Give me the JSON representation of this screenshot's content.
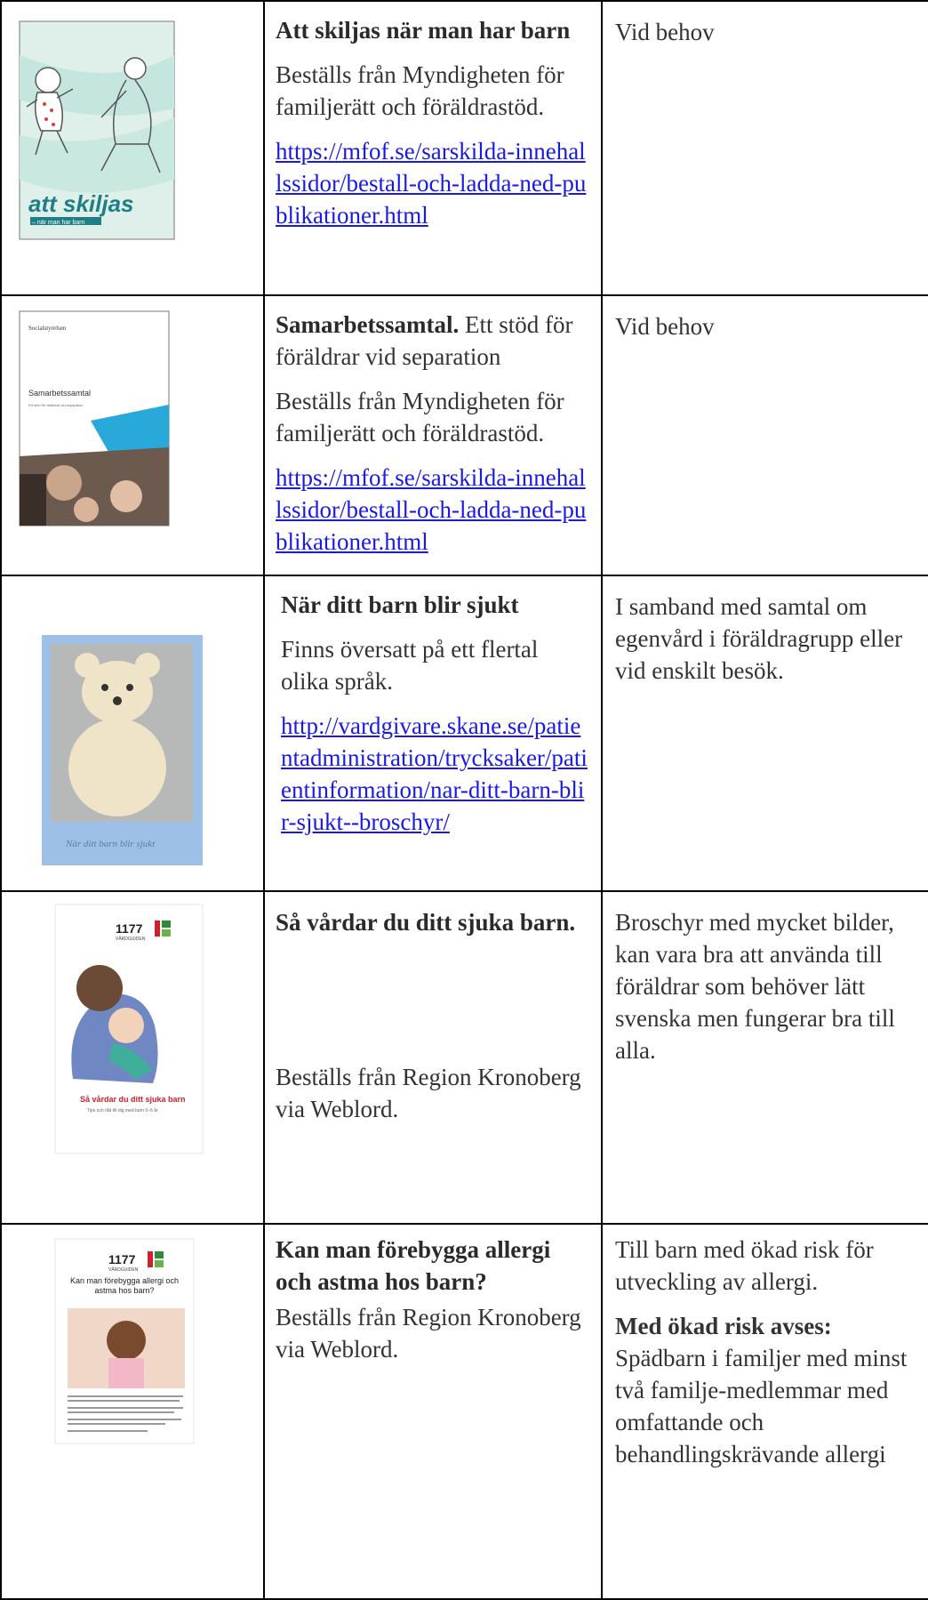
{
  "rows": [
    {
      "title": "Att skiljas när man har barn",
      "subtitle": "",
      "order": "Beställs från Myndigheten för familjerätt och föräldrastöd.",
      "link": "https://mfof.se/sarskilda-innehallssidor/bestall-och-ladda-ned-publikationer.html",
      "when": "Vid behov",
      "cover": {
        "title": "att skiljas",
        "subtitle": "– när man har barn"
      }
    },
    {
      "title": "Samarbetssamtal.",
      "subtitle": " Ett stöd för föräldrar vid separation",
      "order": "Beställs från Myndigheten för familjerätt och föräldrastöd.",
      "link": "https://mfof.se/sarskilda-innehallssidor/bestall-och-ladda-ned-publikationer.html",
      "when": "Vid behov",
      "cover": {
        "publisher": "Socialstyrelsen",
        "title": "Samarbetssamtal",
        "subtitle": "Ett stöd för föräldrar vid separation"
      }
    },
    {
      "title": "När ditt barn blir sjukt",
      "order": "Finns översatt på ett flertal olika språk.",
      "link": "http://vardgivare.skane.se/patientadministration/trycksaker/patientinformation/nar-ditt-barn-blir-sjukt--broschyr/",
      "when": "I samband med samtal om egenvård i föräldragrupp eller vid enskilt besök.",
      "cover": {
        "title": "När ditt barn blir sjukt"
      }
    },
    {
      "title": "Så vårdar du ditt sjuka barn.",
      "order": "Beställs från Region Kronoberg via Weblord.",
      "when": "Broschyr med mycket bilder, kan vara bra att använda till föräldrar som behöver lätt svenska men fungerar bra till alla.",
      "cover": {
        "brand": "1177",
        "brand_sub": "VÅRDGUIDEN",
        "title": "Så vårdar du ditt sjuka barn",
        "subtitle": "Tips och råd till dig med barn 0–6 år"
      }
    },
    {
      "title": "Kan man förebygga allergi och astma hos barn?",
      "order": "Beställs från Region Kronoberg via Weblord.",
      "when": "Till barn med ökad risk för utveckling av allergi.",
      "risk_heading": "Med ökad risk avses:",
      "risk_text": "Spädbarn i familjer med minst två familje-medlemmar med omfattande och behandlingskrävande allergi",
      "cover": {
        "brand": "1177",
        "brand_sub": "VÅRDGUIDEN",
        "title": "Kan man förebygga allergi och astma hos barn?"
      }
    }
  ],
  "colors": {
    "link": "#1a1ae6",
    "cover_mint": "#dff0ea",
    "cover_teal": "#2a8f94",
    "cover_sky": "#9ec0e6",
    "cover_red": "#d0202e"
  }
}
